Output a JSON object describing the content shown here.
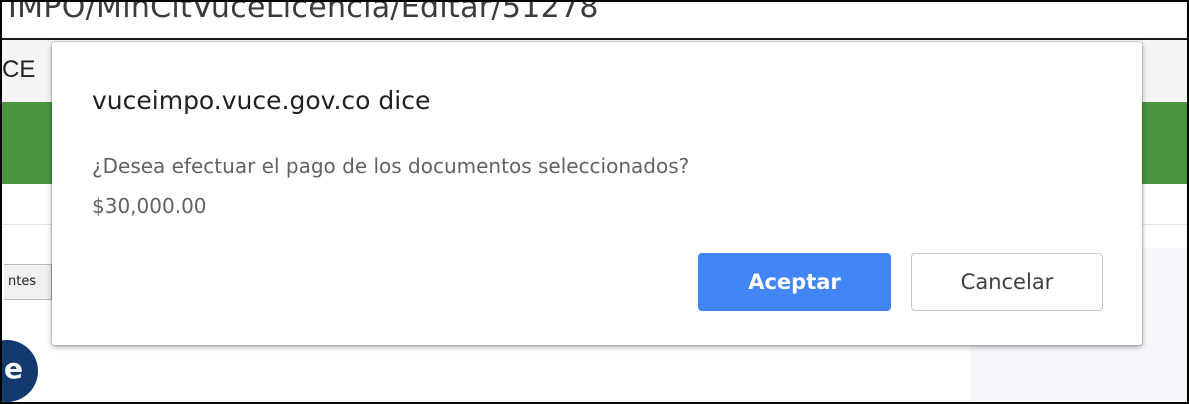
{
  "browser": {
    "url_fragment": "IMPO/MinCitVuceLicencia/Editar/51278"
  },
  "page": {
    "nav_label_fragment": "CE",
    "tab_label_fragment": "ntes",
    "circle_glyph": "e"
  },
  "dialog": {
    "title": "vuceimpo.vuce.gov.co dice",
    "message_line1": "¿Desea efectuar el pago de los documentos seleccionados?",
    "message_line2": "$30,000.00",
    "accept_label": "Aceptar",
    "cancel_label": "Cancelar"
  },
  "colors": {
    "accent_button": "#4285f4",
    "header_band": "#4a9440",
    "circle_badge": "#123a6e"
  }
}
